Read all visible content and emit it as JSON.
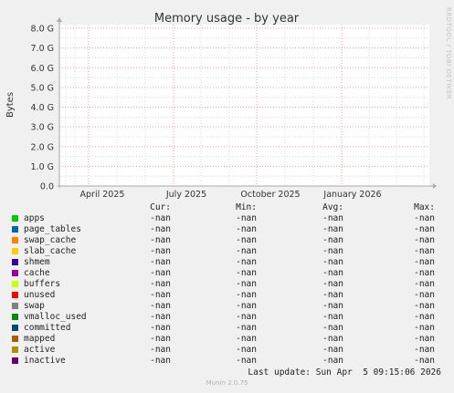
{
  "chart_data": {
    "type": "line",
    "title": "Memory usage - by year",
    "ylabel": "Bytes",
    "ylim": [
      0,
      8.0
    ],
    "y_unit": "G",
    "y_ticks": [
      "0.0",
      "1.0 G",
      "2.0 G",
      "3.0 G",
      "4.0 G",
      "5.0 G",
      "6.0 G",
      "7.0 G",
      "8.0 G"
    ],
    "x_ticks": [
      "April 2025",
      "July 2025",
      "October 2025",
      "January 2026"
    ],
    "grid": true,
    "series": [
      {
        "name": "apps",
        "color": "#00cc00",
        "cur": "-nan",
        "min": "-nan",
        "avg": "-nan",
        "max": "-nan"
      },
      {
        "name": "page_tables",
        "color": "#0066b3",
        "cur": "-nan",
        "min": "-nan",
        "avg": "-nan",
        "max": "-nan"
      },
      {
        "name": "swap_cache",
        "color": "#ff8000",
        "cur": "-nan",
        "min": "-nan",
        "avg": "-nan",
        "max": "-nan"
      },
      {
        "name": "slab_cache",
        "color": "#ffcc00",
        "cur": "-nan",
        "min": "-nan",
        "avg": "-nan",
        "max": "-nan"
      },
      {
        "name": "shmem",
        "color": "#330099",
        "cur": "-nan",
        "min": "-nan",
        "avg": "-nan",
        "max": "-nan"
      },
      {
        "name": "cache",
        "color": "#990099",
        "cur": "-nan",
        "min": "-nan",
        "avg": "-nan",
        "max": "-nan"
      },
      {
        "name": "buffers",
        "color": "#ccff00",
        "cur": "-nan",
        "min": "-nan",
        "avg": "-nan",
        "max": "-nan"
      },
      {
        "name": "unused",
        "color": "#ff0000",
        "cur": "-nan",
        "min": "-nan",
        "avg": "-nan",
        "max": "-nan"
      },
      {
        "name": "swap",
        "color": "#808080",
        "cur": "-nan",
        "min": "-nan",
        "avg": "-nan",
        "max": "-nan"
      },
      {
        "name": "vmalloc_used",
        "color": "#008f00",
        "cur": "-nan",
        "min": "-nan",
        "avg": "-nan",
        "max": "-nan"
      },
      {
        "name": "committed",
        "color": "#00487d",
        "cur": "-nan",
        "min": "-nan",
        "avg": "-nan",
        "max": "-nan"
      },
      {
        "name": "mapped",
        "color": "#b35a00",
        "cur": "-nan",
        "min": "-nan",
        "avg": "-nan",
        "max": "-nan"
      },
      {
        "name": "active",
        "color": "#b38f00",
        "cur": "-nan",
        "min": "-nan",
        "avg": "-nan",
        "max": "-nan"
      },
      {
        "name": "inactive",
        "color": "#6b006b",
        "cur": "-nan",
        "min": "-nan",
        "avg": "-nan",
        "max": "-nan"
      }
    ]
  },
  "legend_headers": {
    "cur": "Cur:",
    "min": "Min:",
    "avg": "Avg:",
    "max": "Max:"
  },
  "last_update": "Last update: Sun Apr  5 09:15:06 2026",
  "munin_version": "Munin 2.0.75",
  "watermark": "RRDTOOL / TOBI OETIKER",
  "colors": {
    "background": "#f0f0f0",
    "plot_background": "#ffffff",
    "major_grid": "#e8a0a0",
    "minor_grid": "#d0d8e8",
    "axis": "#aaaaaa"
  }
}
